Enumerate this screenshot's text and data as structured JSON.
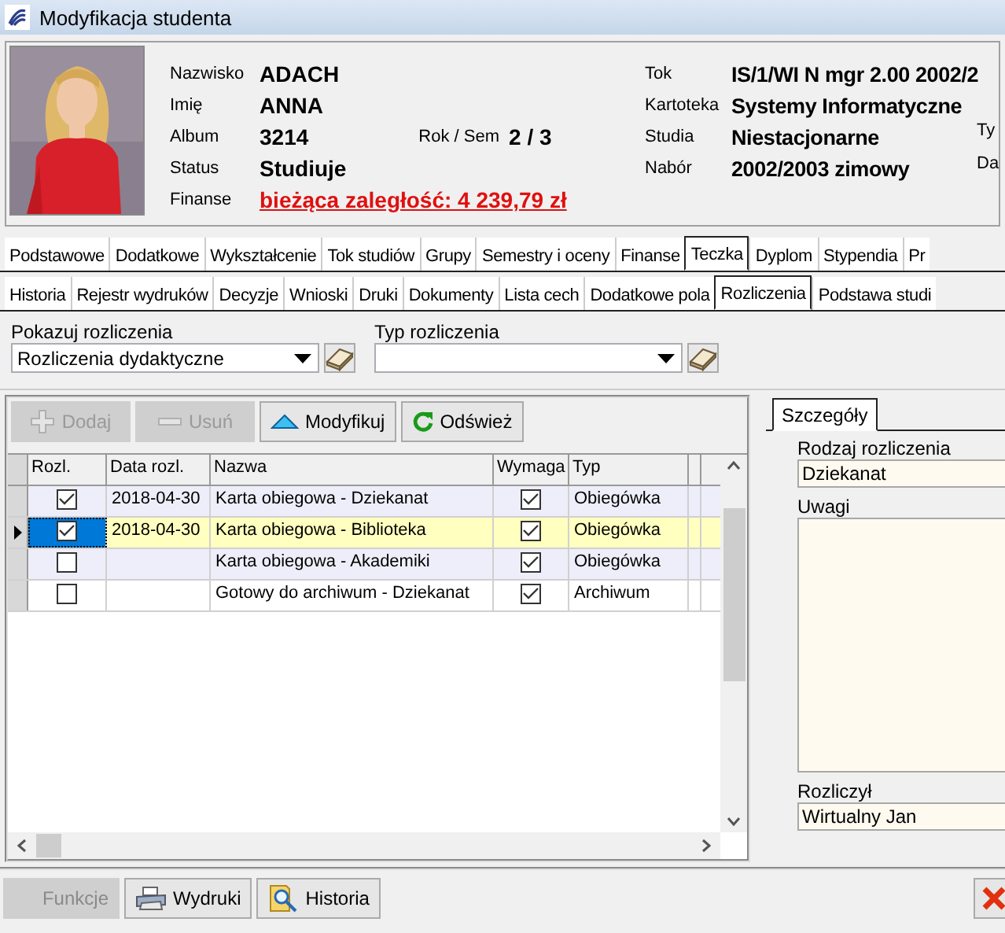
{
  "window": {
    "title": "Modyfikacja studenta"
  },
  "header": {
    "photo": {
      "kind": "picture"
    },
    "left_fields": [
      {
        "label": "Nazwisko",
        "value": "ADACH",
        "kind": "plain"
      },
      {
        "label": "Imię",
        "value": "ANNA",
        "kind": "plain"
      },
      {
        "label": "Album",
        "value": "3214",
        "kind": "plain"
      },
      {
        "label": "Status",
        "value": "Studiuje",
        "kind": "plain"
      },
      {
        "label": "Finanse",
        "value": "bieżąca zaległość: 4 239,79 zł",
        "kind": "alert"
      }
    ],
    "rok_sem": {
      "label": "Rok / Sem",
      "value": "2 / 3"
    },
    "right_fields": [
      {
        "label": "Tok",
        "value": "IS/1/WI N mgr 2.00 2002/2"
      },
      {
        "label": "Kartoteka",
        "value": "Systemy Informatyczne"
      },
      {
        "label": "Studia",
        "value": "Niestacjonarne"
      },
      {
        "label": "Nabór",
        "value": "2002/2003 zimowy"
      }
    ],
    "edge_labels": [
      "Ty",
      "Da"
    ]
  },
  "tabs_main": [
    {
      "label": "Podstawowe",
      "selected": false
    },
    {
      "label": "Dodatkowe",
      "selected": false
    },
    {
      "label": "Wykształcenie",
      "selected": false
    },
    {
      "label": "Tok studiów",
      "selected": false
    },
    {
      "label": "Grupy",
      "selected": false
    },
    {
      "label": "Semestry i oceny",
      "selected": false
    },
    {
      "label": "Finanse",
      "selected": false
    },
    {
      "label": "Teczka",
      "selected": true
    },
    {
      "label": "Dyplom",
      "selected": false
    },
    {
      "label": "Stypendia",
      "selected": false
    },
    {
      "label": "Pr",
      "selected": false
    }
  ],
  "tabs_sub": [
    {
      "label": "Historia",
      "selected": false
    },
    {
      "label": "Rejestr wydruków",
      "selected": false
    },
    {
      "label": "Decyzje",
      "selected": false
    },
    {
      "label": "Wnioski",
      "selected": false
    },
    {
      "label": "Druki",
      "selected": false
    },
    {
      "label": "Dokumenty",
      "selected": false
    },
    {
      "label": "Lista cech",
      "selected": false
    },
    {
      "label": "Dodatkowe pola",
      "selected": false
    },
    {
      "label": "Rozliczenia",
      "selected": true
    },
    {
      "label": "Podstawa studi",
      "selected": false
    }
  ],
  "filters": [
    {
      "label": "Pokazuj rozliczenia",
      "value": "Rozliczenia dydaktyczne"
    },
    {
      "label": "Typ rozliczenia"
    }
  ],
  "toolbar": [
    {
      "label": "Dodaj",
      "kind": "add",
      "disabled": true
    },
    {
      "label": "Usuń",
      "kind": "remove",
      "disabled": true
    },
    {
      "label": "Modyfikuj",
      "kind": "edit",
      "disabled": false
    },
    {
      "label": "Odśwież",
      "kind": "refresh",
      "disabled": false
    }
  ],
  "table": {
    "columns": [
      "Rozl.",
      "Data rozl.",
      "Nazwa",
      "Wymaga",
      "Typ"
    ],
    "rows": [
      {
        "settled": true,
        "date": "2018-04-30",
        "name": "Karta obiegowa - Dziekanat",
        "required": true,
        "type": "Obiegówka",
        "selected": false
      },
      {
        "settled": true,
        "date": "2018-04-30",
        "name": "Karta obiegowa - Biblioteka",
        "required": true,
        "type": "Obiegówka",
        "selected": true
      },
      {
        "settled": false,
        "name": "Karta obiegowa - Akademiki",
        "required": true,
        "type": "Obiegówka",
        "selected": false
      },
      {
        "settled": false,
        "name": "Gotowy do archiwum - Dziekanat",
        "required": true,
        "type": "Archiwum",
        "selected": false
      }
    ]
  },
  "details": {
    "tab": "Szczegóły",
    "fields": [
      {
        "label": "Rodzaj rozliczenia",
        "value": "Dziekanat",
        "kind": "line"
      },
      {
        "label": "Uwagi",
        "kind": "memo"
      },
      {
        "label": "Rozliczył",
        "value": "Wirtualny Jan",
        "kind": "line"
      }
    ]
  },
  "bottom_buttons": [
    {
      "label": "Funkcje",
      "kind": "functions",
      "disabled": true
    },
    {
      "label": "Wydruki",
      "kind": "print",
      "disabled": false
    },
    {
      "label": "Historia",
      "kind": "history",
      "disabled": false
    }
  ]
}
